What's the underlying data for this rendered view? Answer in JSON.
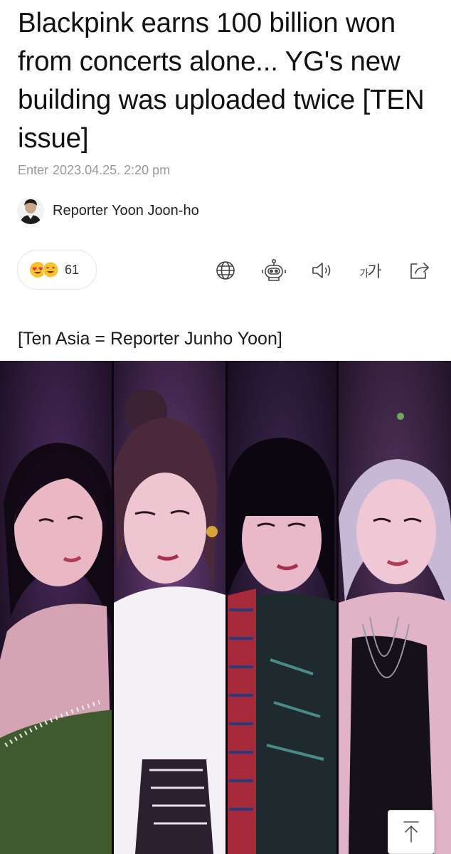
{
  "article": {
    "title": "Blackpink earns 100 billion won from concerts alone... YG's new building was uploaded twice [TEN issue]",
    "enter_label": "Enter",
    "timestamp": "2023.04.25. 2:20 pm",
    "reporter": "Reporter Yoon Joon-ho",
    "caption": "[Ten Asia = Reporter Junho Yoon]"
  },
  "reactions": {
    "count": "61",
    "emojis": [
      "heart-eyes-emoji",
      "grinning-emoji"
    ]
  },
  "toolbar": {
    "icons": [
      "globe-icon",
      "robot-icon",
      "speaker-icon",
      "font-size-icon",
      "share-icon"
    ],
    "font_size_small": "가",
    "font_size_large": "가"
  },
  "colors": {
    "meta_text": "#9a9a9a",
    "photo_background": "#170d1e",
    "emoji_yellow": "#f9c12e",
    "emoji_heart": "#e8283c"
  }
}
